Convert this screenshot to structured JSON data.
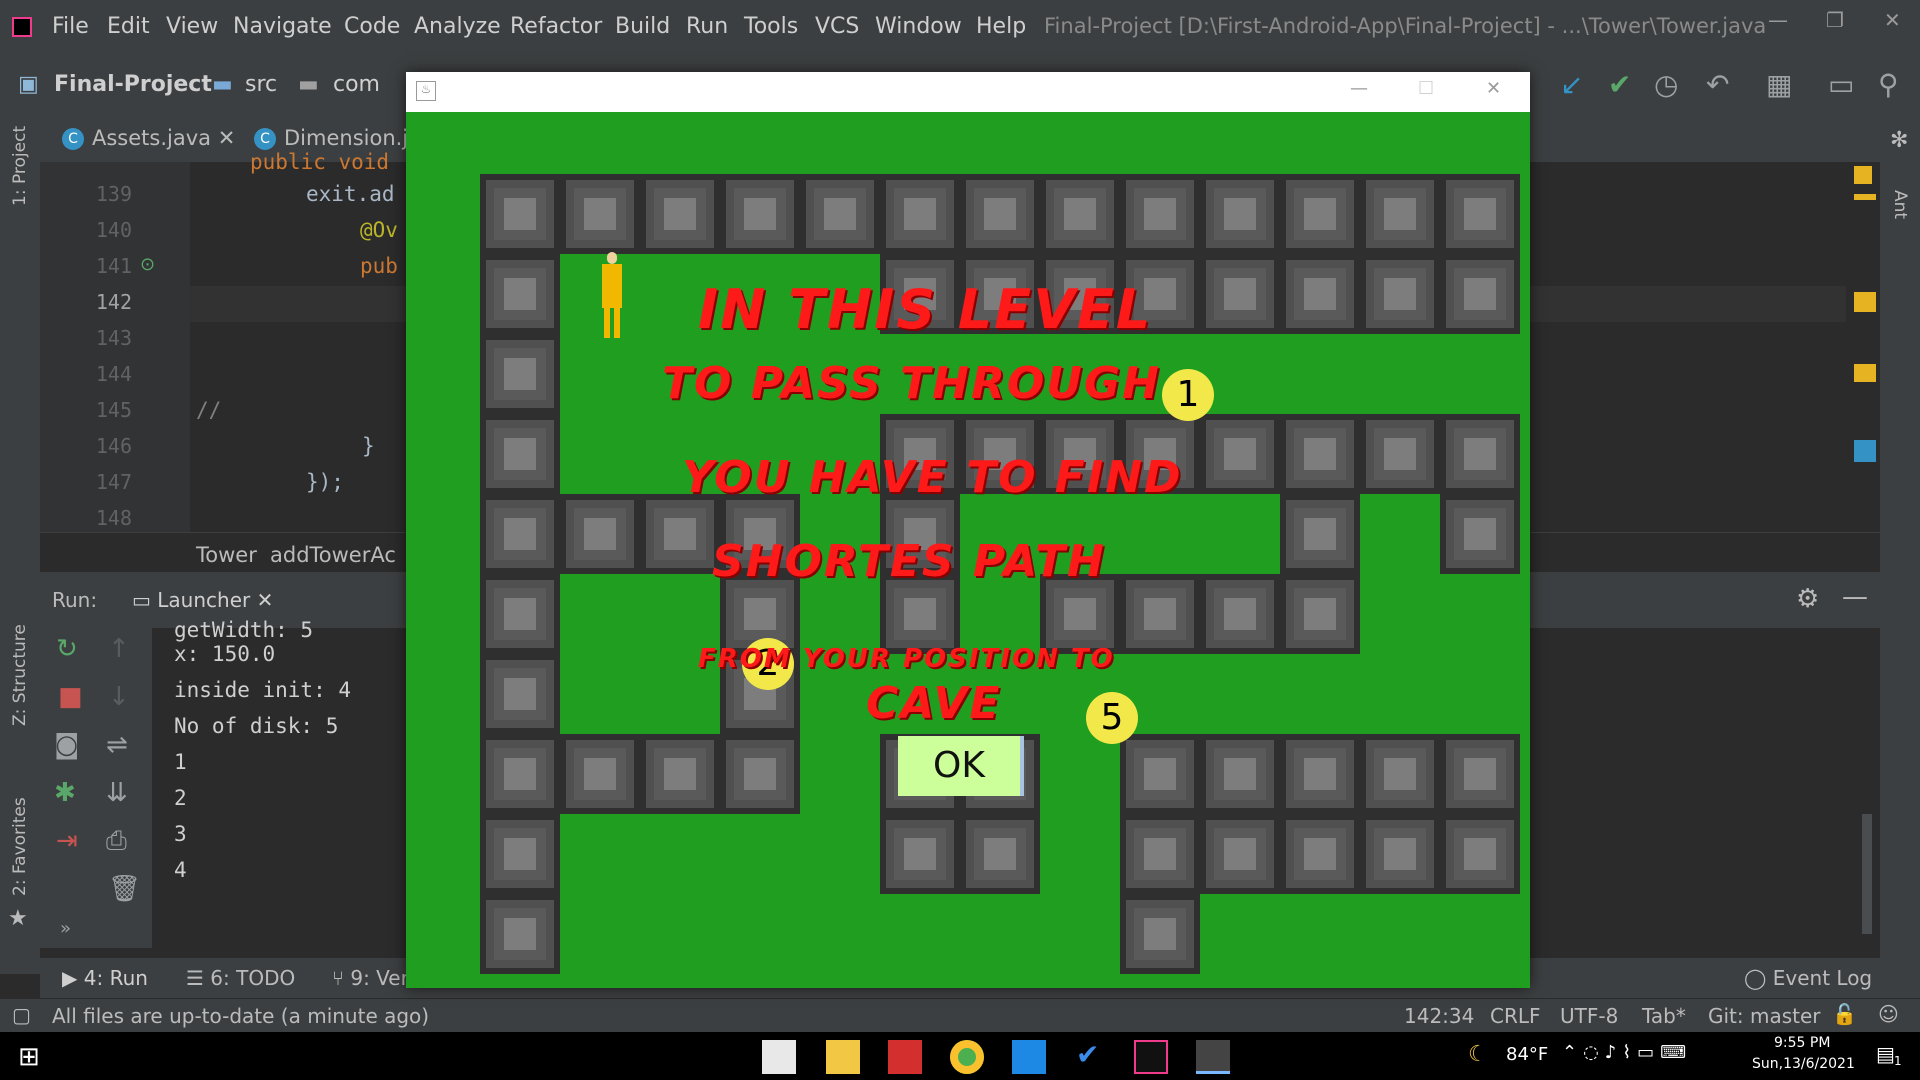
{
  "menu": {
    "items": [
      "File",
      "Edit",
      "View",
      "Navigate",
      "Code",
      "Analyze",
      "Refactor",
      "Build",
      "Run",
      "Tools",
      "VCS",
      "Window",
      "Help"
    ],
    "title": "Final-Project [D:\\First-Android-App\\Final-Project] - ...\\Tower\\Tower.java"
  },
  "nav": {
    "project": "Final-Project",
    "crumb1": "src",
    "crumb2": "com"
  },
  "side": {
    "project": "1: Project",
    "structure": "Z: Structure",
    "favorites": "2: Favorites",
    "ant": "Ant"
  },
  "tabs": {
    "tab1": "Assets.java",
    "tab2": "Dimension.ja"
  },
  "editor": {
    "lines": [
      {
        "num": "139",
        "code": "exit.ad"
      },
      {
        "num": "140",
        "code": "@Ov"
      },
      {
        "num": "141",
        "code": "pub"
      },
      {
        "num": "142",
        "code": ""
      },
      {
        "num": "143",
        "code": ""
      },
      {
        "num": "144",
        "code": ""
      },
      {
        "num": "145",
        "code": "//"
      },
      {
        "num": "146",
        "code": "}"
      },
      {
        "num": "147",
        "code": "});"
      },
      {
        "num": "148",
        "code": ""
      }
    ],
    "top_partial": "public void"
  },
  "breadcrumbs": {
    "class": "Tower",
    "method": "addTowerAc"
  },
  "run": {
    "label": "Run:",
    "tab": "Launcher",
    "console": [
      "x: 150.0",
      "inside init: 4",
      "No of disk: 5",
      "1",
      "2",
      "3",
      "4"
    ],
    "console_partial": "getWidth: 5"
  },
  "bottom_tabs": {
    "run": "4: Run",
    "todo": "6: TODO",
    "vcs": "9: Ver",
    "event_log": "Event Log"
  },
  "status": {
    "message": "All files are up-to-date (a minute ago)",
    "position": "142:34",
    "line_sep": "CRLF",
    "encoding": "UTF-8",
    "indent": "Tab*",
    "git": "Git: master"
  },
  "taskbar": {
    "temp": "84°F",
    "time": "9:55 PM",
    "date": "Sun,13/6/2021",
    "notif": "1"
  },
  "game": {
    "messages": [
      "IN THIS LEVEL",
      "TO PASS THROUGH",
      "YOU HAVE TO FIND",
      "SHORTES PATH",
      "FROM YOUR POSITION TO",
      "CAVE"
    ],
    "ok_label": "OK",
    "disks": [
      "1",
      "2",
      "5"
    ],
    "colors": {
      "grass": "#1f9e1f",
      "wall": "#5a5a5a",
      "text": "#ff1a1a",
      "disk": "#f2e84a",
      "ok_bg": "#ccff99"
    }
  }
}
